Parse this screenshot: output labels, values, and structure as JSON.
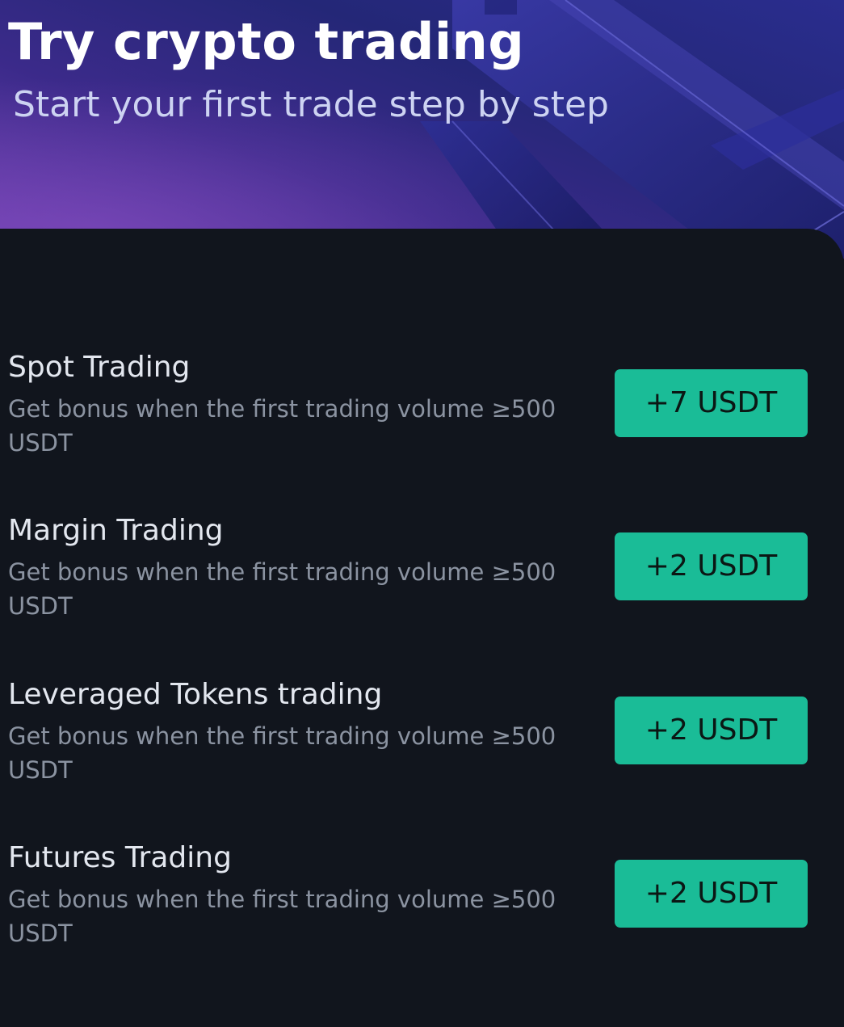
{
  "header": {
    "title": "Try crypto trading",
    "subtitle": "Start your first trade step by step"
  },
  "tasks": [
    {
      "title": "Spot Trading",
      "description": "Get bonus when the first trading volume ≥500 USDT",
      "reward": "+7 USDT"
    },
    {
      "title": "Margin Trading",
      "description": "Get bonus when the first trading volume ≥500 USDT",
      "reward": "+2 USDT"
    },
    {
      "title": "Leveraged Tokens trading",
      "description": "Get bonus when the first trading volume ≥500 USDT",
      "reward": "+2 USDT"
    },
    {
      "title": "Futures Trading",
      "description": "Get bonus when the first trading volume ≥500 USDT",
      "reward": "+2 USDT"
    }
  ],
  "colors": {
    "background": "#11151d",
    "accent": "#1abc97",
    "title_text": "#e3e7ef",
    "description_text": "#8b93a1",
    "hero_purple": "#3b2a8a"
  }
}
